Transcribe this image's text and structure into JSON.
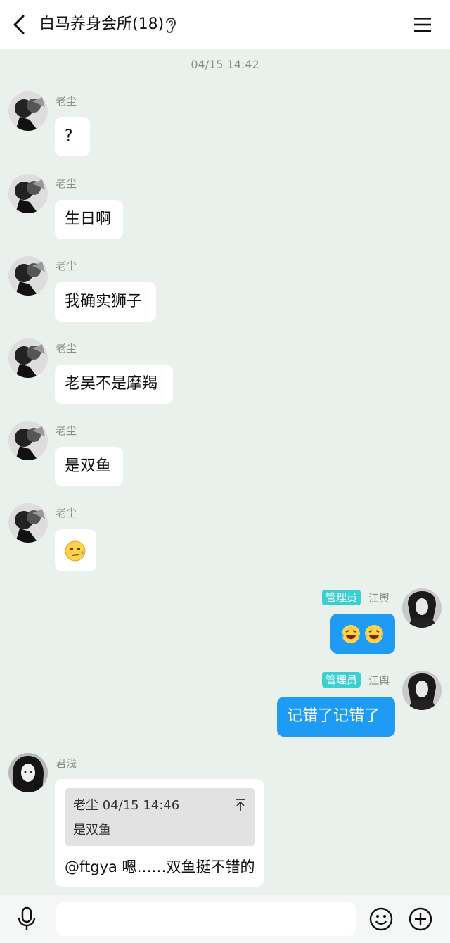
{
  "header": {
    "title": "白马养身会所(18)"
  },
  "timestamp": "04/15 14:42",
  "messages": [
    {
      "sender": "老尘",
      "text": "?"
    },
    {
      "sender": "老尘",
      "text": "生日啊"
    },
    {
      "sender": "老尘",
      "text": "我确实狮子"
    },
    {
      "sender": "老尘",
      "text": "老吴不是摩羯"
    },
    {
      "sender": "老尘",
      "text": "是双鱼"
    },
    {
      "sender": "老尘",
      "emoji": "sweat-face"
    },
    {
      "sender": "江舆",
      "role": "管理员",
      "emoji": "laughing-tears x2"
    },
    {
      "sender": "江舆",
      "role": "管理员",
      "text": "记错了记错了"
    },
    {
      "sender": "君浅",
      "quote": {
        "header": "老尘 04/15 14:46",
        "text": "是双鱼"
      },
      "text": "@ftgya 嗯……双鱼挺不错的"
    }
  ],
  "colors": {
    "background": "#eaf0ec",
    "mine_bubble": "#1d9bf5",
    "role_badge": "#38d0d0"
  },
  "icons": [
    "back-icon",
    "ear-icon",
    "menu-icon",
    "mic-icon",
    "emoji-icon",
    "plus-icon"
  ]
}
